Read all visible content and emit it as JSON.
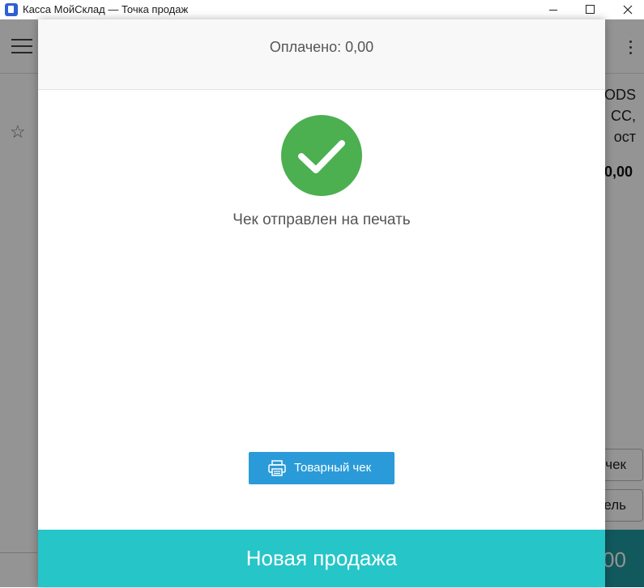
{
  "window": {
    "title": "Касса МойСклад — Точка продаж",
    "app_icon": "app-icon",
    "controls": [
      "minimize-icon",
      "maximize-icon",
      "close-icon"
    ]
  },
  "background": {
    "product_name": "ODS\nCC,\nост",
    "price": "0,00",
    "button_1": "чек",
    "button_2": "ель",
    "total": "00"
  },
  "modal": {
    "paid_text": "Оплачено: 0,00",
    "status_icon": "checkmark-icon",
    "status_text": "Чек отправлен на печать",
    "receipt_button": {
      "label": "Товарный чек",
      "icon": "printer-icon"
    },
    "new_sale_button": "Новая продажа"
  },
  "colors": {
    "success": "#4caf50",
    "primary_button": "#2a9bd8",
    "new_sale": "#26c5c8"
  }
}
